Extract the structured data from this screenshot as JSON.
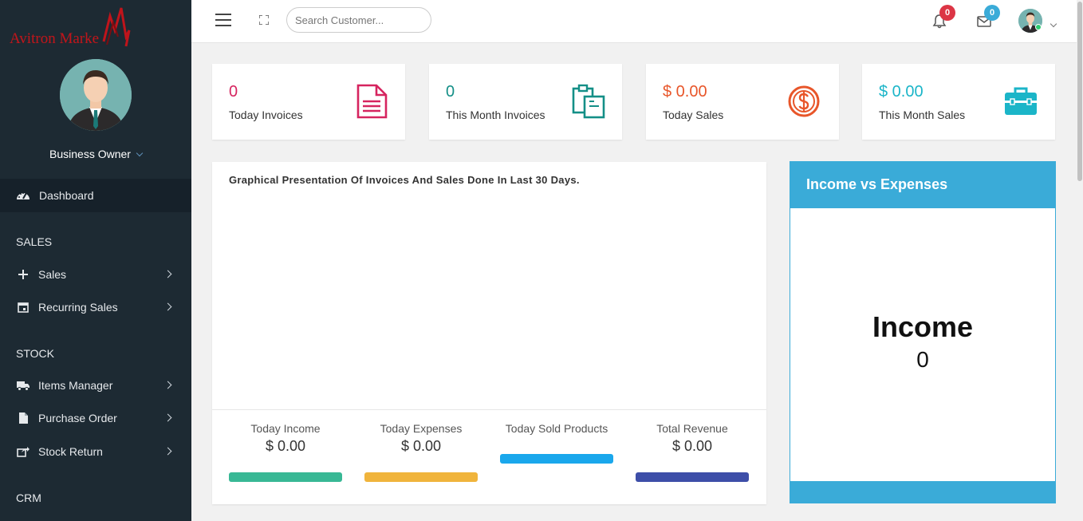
{
  "app": {
    "logo_text": "Avitron Marke"
  },
  "sidebar": {
    "owner": "Business Owner",
    "dashboard": "Dashboard",
    "sections": [
      {
        "title": "SALES",
        "items": [
          {
            "label": "Sales",
            "icon": "plus-icon"
          },
          {
            "label": "Recurring Sales",
            "icon": "calendar-icon"
          }
        ]
      },
      {
        "title": "STOCK",
        "items": [
          {
            "label": "Items Manager",
            "icon": "truck-icon"
          },
          {
            "label": "Purchase Order",
            "icon": "document-icon"
          },
          {
            "label": "Stock Return",
            "icon": "share-icon"
          }
        ]
      },
      {
        "title": "CRM",
        "items": []
      }
    ]
  },
  "topbar": {
    "search_placeholder": "Search Customer...",
    "notifications_count": "0",
    "messages_count": "0"
  },
  "cards": [
    {
      "value": "0",
      "label": "Today Invoices",
      "color": "#d6245f",
      "icon": "invoice-icon"
    },
    {
      "value": "0",
      "label": "This Month Invoices",
      "color": "#148f87",
      "icon": "clipboard-icon"
    },
    {
      "value": "$ 0.00",
      "label": "Today Sales",
      "color": "#e8562a",
      "icon": "dollar-icon"
    },
    {
      "value": "$ 0.00",
      "label": "This Month Sales",
      "color": "#1bb5c8",
      "icon": "briefcase-icon"
    }
  ],
  "chart_panel": {
    "title": "Graphical Presentation Of Invoices And Sales Done In Last 30 Days.",
    "stats": [
      {
        "label": "Today Income",
        "value": "$ 0.00",
        "color": "#38b895"
      },
      {
        "label": "Today Expenses",
        "value": "$ 0.00",
        "color": "#f0b43c"
      },
      {
        "label": "Today Sold Products",
        "value": "",
        "color": "#1aa7ec"
      },
      {
        "label": "Total Revenue",
        "value": "$ 0.00",
        "color": "#3d4ea8"
      }
    ]
  },
  "income_expenses": {
    "header": "Income vs Expenses",
    "title": "Income",
    "value": "0",
    "accent": "#3aabd8"
  }
}
